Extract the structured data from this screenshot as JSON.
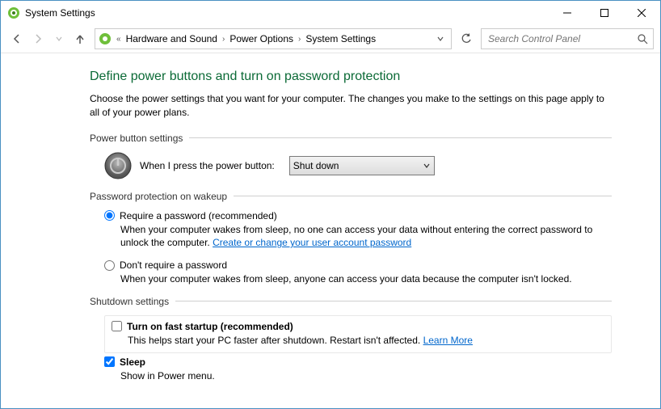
{
  "window": {
    "title": "System Settings"
  },
  "nav": {
    "breadcrumb": [
      "Hardware and Sound",
      "Power Options",
      "System Settings"
    ],
    "search_placeholder": "Search Control Panel"
  },
  "page": {
    "title": "Define power buttons and turn on password protection",
    "desc": "Choose the power settings that you want for your computer. The changes you make to the settings on this page apply to all of your power plans."
  },
  "power_button": {
    "section_label": "Power button settings",
    "label": "When I press the power button:",
    "selected": "Shut down"
  },
  "password": {
    "section_label": "Password protection on wakeup",
    "opt1_label": "Require a password (recommended)",
    "opt1_desc_a": "When your computer wakes from sleep, no one can access your data without entering the correct password to unlock the computer. ",
    "opt1_link": "Create or change your user account password",
    "opt2_label": "Don't require a password",
    "opt2_desc": "When your computer wakes from sleep, anyone can access your data because the computer isn't locked."
  },
  "shutdown": {
    "section_label": "Shutdown settings",
    "fast_label": "Turn on fast startup (recommended)",
    "fast_desc": "This helps start your PC faster after shutdown. Restart isn't affected. ",
    "fast_link": "Learn More",
    "sleep_label": "Sleep",
    "sleep_desc": "Show in Power menu."
  }
}
